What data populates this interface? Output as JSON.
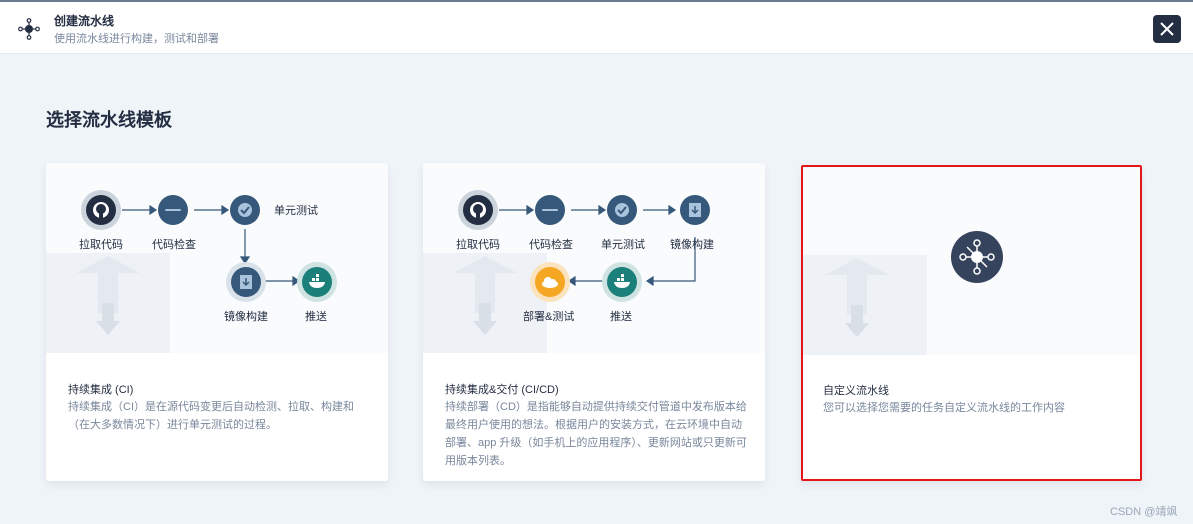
{
  "header": {
    "title": "创建流水线",
    "subtitle": "使用流水线进行构建，测试和部署",
    "icon": "pipeline-icon",
    "close_icon": "close-icon"
  },
  "section_title": "选择流水线模板",
  "cards": [
    {
      "title": "持续集成 (CI)",
      "description": "持续集成（CI）是在源代码变更后自动检测、拉取、构建和（在大多数情况下）进行单元测试的过程。",
      "steps": [
        "拉取代码",
        "代码检查",
        "单元测试",
        "镜像构建",
        "推送"
      ]
    },
    {
      "title": "持续集成&交付 (CI/CD)",
      "description": "持续部署（CD）是指能够自动提供持续交付管道中发布版本给最终用户使用的想法。根据用户的安装方式，在云环境中自动部署、app 升级（如手机上的应用程序）、更新网站或只更新可用版本列表。",
      "steps": [
        "拉取代码",
        "代码检查",
        "单元测试",
        "镜像构建",
        "推送",
        "部署&测试"
      ]
    },
    {
      "title": "自定义流水线",
      "description": "您可以选择您需要的任务自定义流水线的工作内容",
      "icon": "pipeline-icon"
    }
  ],
  "watermark": "CSDN @靖飒",
  "colors": {
    "dark": "#242e42",
    "node_blue": "#36587a",
    "docker_teal": "#1b7f7a",
    "cloud_orange": "#f5a623",
    "selected_border": "#e4161a",
    "muted_text": "#79879c"
  }
}
